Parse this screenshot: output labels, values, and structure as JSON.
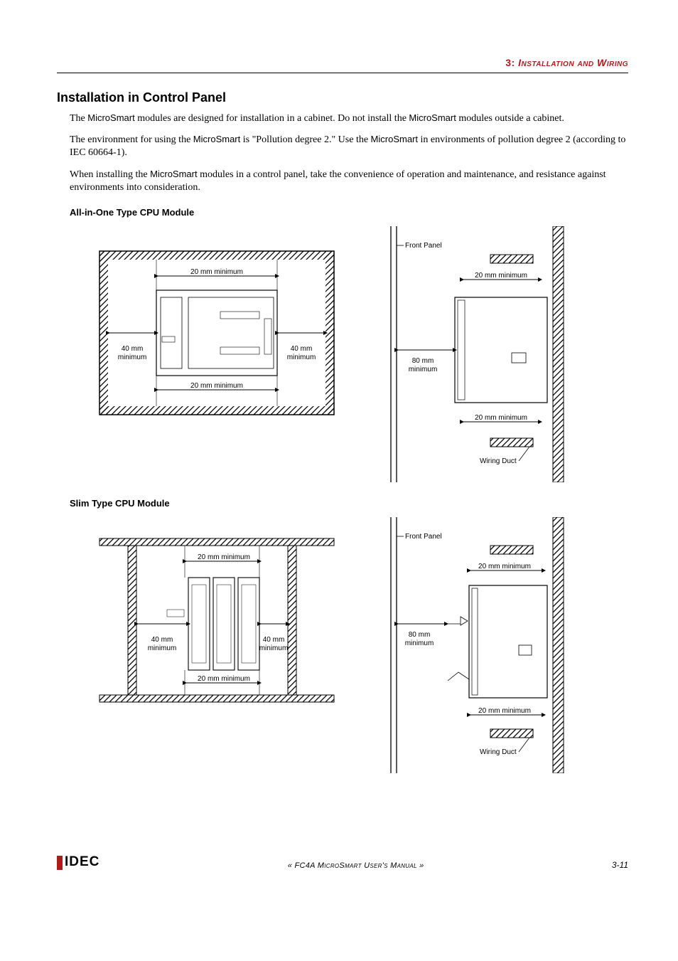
{
  "header": {
    "chapter_num": "3:",
    "chapter_title": "Installation and Wiring"
  },
  "title": "Installation in Control Panel",
  "para1_a": "The ",
  "para1_b": "MicroSmart",
  "para1_c": " modules are designed for installation in a cabinet. Do not install the ",
  "para1_d": "MicroSmart",
  "para1_e": " modules outside a cabinet.",
  "para2_a": "The environment for using the ",
  "para2_b": "MicroSmart",
  "para2_c": " is \"Pollution degree 2.\" Use the ",
  "para2_d": "MicroSmart",
  "para2_e": " in environments of pollution degree 2 (according to IEC 60664-1).",
  "para3_a": "When installing the ",
  "para3_b": "MicroSmart",
  "para3_c": " modules in a control panel, take the convenience of operation and maintenance, and resistance against environments into consideration.",
  "sub1": "All-in-One Type CPU Module",
  "sub2": "Slim Type CPU Module",
  "labels": {
    "min20": "20 mm minimum",
    "min40a": "40 mm",
    "min40b": "minimum",
    "min80a": "80 mm",
    "min80b": "minimum",
    "front_panel": "Front Panel",
    "wiring_duct": "Wiring Duct"
  },
  "footer": {
    "logo": "IDEC",
    "center": "« FC4A MicroSmart User's Manual »",
    "page": "3-11"
  }
}
